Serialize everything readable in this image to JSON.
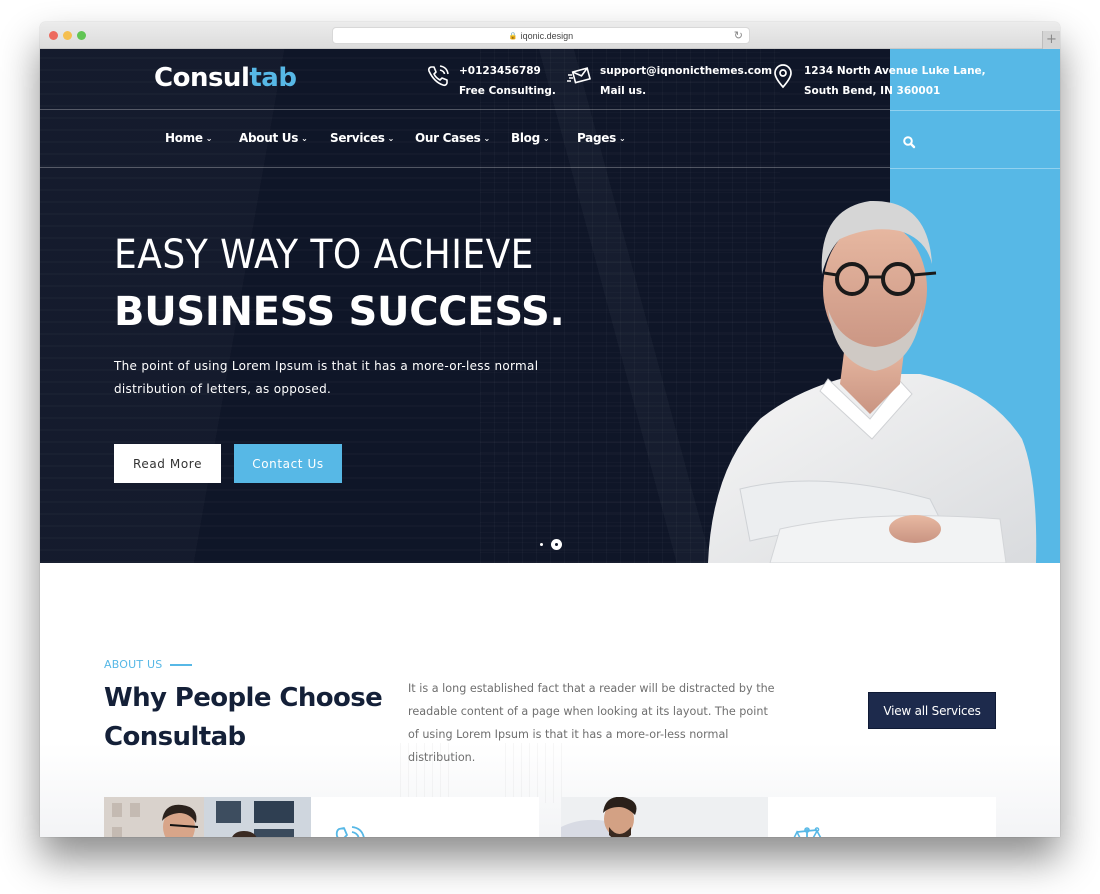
{
  "browser": {
    "url": "iqonic.design",
    "new_tab_label": "+"
  },
  "header": {
    "logo_main": "Consul",
    "logo_accent": "tab",
    "contacts": [
      {
        "icon": "phone-icon",
        "line1": "+0123456789",
        "line2": "Free Consulting."
      },
      {
        "icon": "mail-icon",
        "line1": "support@iqnonicthemes.com",
        "line2": "Mail us."
      },
      {
        "icon": "location-pin-icon",
        "line1": "1234 North Avenue Luke Lane,",
        "line2": "South Bend, IN 360001"
      }
    ]
  },
  "nav": {
    "items": [
      {
        "label": "Home"
      },
      {
        "label": "About Us"
      },
      {
        "label": "Services"
      },
      {
        "label": "Our Cases"
      },
      {
        "label": "Blog"
      },
      {
        "label": "Pages"
      }
    ],
    "search_icon": "search-icon"
  },
  "hero": {
    "title_light": "EASY WAY TO ACHIEVE",
    "title_bold": "BUSINESS SUCCESS.",
    "paragraph": "The point of using Lorem Ipsum is that it has a more-or-less normal distribution of letters, as opposed.",
    "read_more_label": "Read More",
    "contact_label": "Contact Us",
    "slides_total": 2,
    "active_slide": 2
  },
  "about": {
    "kicker": "ABOUT US",
    "title": "Why People Choose Consultab",
    "text": "It is a long established fact that a reader will be distracted by the readable content of a page when looking at its layout. The point of using Lorem Ipsum is that it has a more-or-less normal distribution.",
    "button_label": "View all Services"
  },
  "cards": [
    {
      "icon": "phone-icon"
    },
    {
      "icon": "scales-icon"
    }
  ],
  "colors": {
    "accent": "#57b8e6",
    "dark_navy": "#0f1628",
    "button_navy": "#1d2a4c",
    "heading": "#142038"
  }
}
